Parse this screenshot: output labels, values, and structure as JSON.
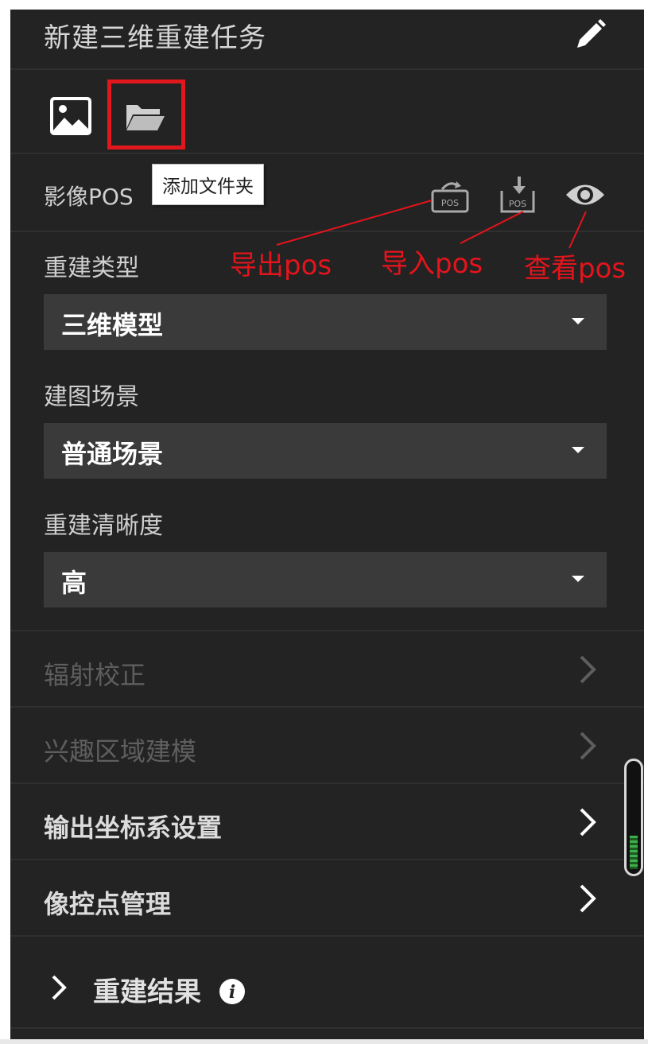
{
  "header": {
    "title": "新建三维重建任务",
    "edit_icon": "pencil-icon"
  },
  "toolbar": {
    "image_icon": "image-icon",
    "folder_icon": "folder-open-icon",
    "highlight_color": "#e2161d"
  },
  "tooltip": {
    "text": "添加文件夹"
  },
  "pos_section": {
    "label": "影像POS",
    "export_icon": "export-pos-icon",
    "import_icon": "import-pos-icon",
    "view_icon": "eye-icon"
  },
  "annotations": {
    "export": "导出pos",
    "import": "导入pos",
    "view": "查看pos",
    "color": "#e4141c"
  },
  "fields": {
    "recon_type": {
      "label": "重建类型",
      "value": "三维模型"
    },
    "scene": {
      "label": "建图场景",
      "value": "普通场景"
    },
    "clarity": {
      "label": "重建清晰度",
      "value": "高"
    }
  },
  "nav": {
    "radiometric": {
      "label": "辐射校正",
      "enabled": false
    },
    "roi": {
      "label": "兴趣区域建模",
      "enabled": false
    },
    "output_crs": {
      "label": "输出坐标系设置",
      "enabled": true
    },
    "gcp": {
      "label": "像控点管理",
      "enabled": true
    }
  },
  "result": {
    "label": "重建结果",
    "info_icon": "info-icon"
  },
  "colors": {
    "panel_bg": "#232323",
    "select_bg": "#3a3a3a",
    "scroll_thumb": "#3fae4c"
  }
}
